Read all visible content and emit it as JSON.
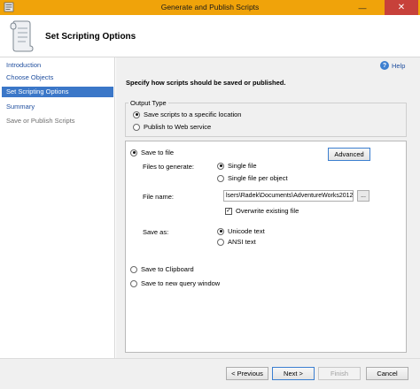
{
  "window": {
    "title": "Generate and Publish Scripts",
    "minimize_glyph": "—",
    "close_glyph": "✕",
    "titlebar_color": "#f0a30a"
  },
  "header": {
    "title": "Set Scripting Options"
  },
  "nav": {
    "items": [
      {
        "label": "Introduction",
        "state": "normal"
      },
      {
        "label": "Choose Objects",
        "state": "normal"
      },
      {
        "label": "Set Scripting Options",
        "state": "active"
      },
      {
        "label": "Summary",
        "state": "normal"
      },
      {
        "label": "Save or Publish Scripts",
        "state": "disabled"
      }
    ]
  },
  "main": {
    "help_label": "Help",
    "help_glyph": "?",
    "instruction": "Specify how scripts should be saved or published.",
    "output_type": {
      "label": "Output Type",
      "options": [
        "Save scripts to a specific location",
        "Publish to Web service"
      ],
      "selected": "Save scripts to a specific location"
    },
    "save": {
      "save_to_file_label": "Save to file",
      "advanced_label": "Advanced",
      "files_to_generate_label": "Files to generate:",
      "files_options": [
        "Single file",
        "Single file per object"
      ],
      "files_selected": "Single file",
      "file_name_label": "File name:",
      "file_name_value": "lsers\\Radek\\Documents\\AdventureWorks2012.sql",
      "browse_label": "...",
      "overwrite_label": "Overwrite existing file",
      "overwrite_checked": true,
      "overwrite_glyph": "✓",
      "save_as_label": "Save as:",
      "save_as_options": [
        "Unicode text",
        "ANSI text"
      ],
      "save_as_selected": "Unicode text",
      "clipboard_label": "Save to Clipboard",
      "query_window_label": "Save to new query window",
      "destination_selected": "Save to file"
    }
  },
  "footer": {
    "previous_label": "< Previous",
    "next_label": "Next >",
    "finish_label": "Finish",
    "cancel_label": "Cancel"
  },
  "colors": {
    "accent": "#3b77c8",
    "link": "#1f4e9e",
    "close_button": "#c7413a"
  }
}
